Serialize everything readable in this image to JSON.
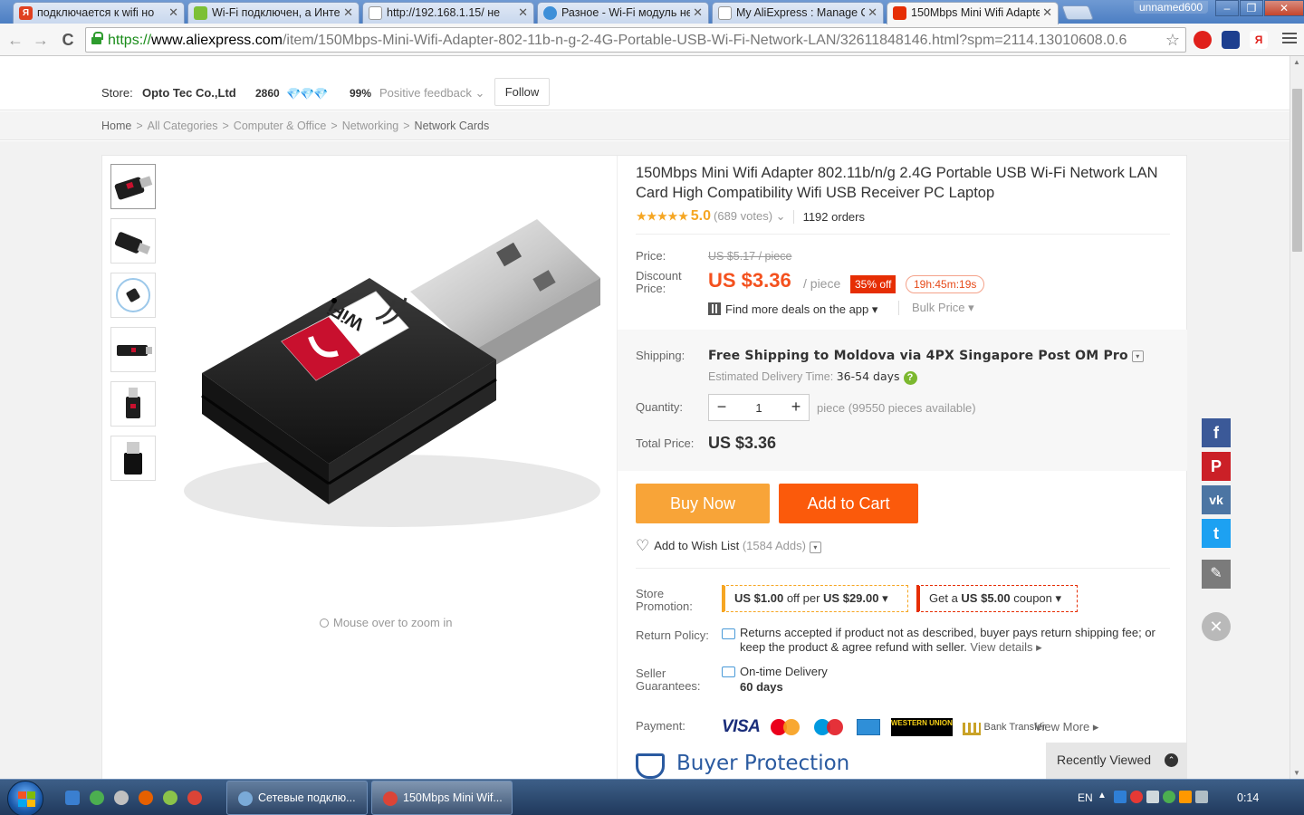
{
  "browser": {
    "tabs": [
      {
        "title": "подключается к wifi но",
        "favicon": "Я",
        "favicon_color": "#e04020",
        "active": false
      },
      {
        "title": "Wi-Fi подключен, а Инте",
        "favicon": "",
        "favicon_color": "#7cc036",
        "active": false
      },
      {
        "title": "http://192.168.1.15/ не",
        "favicon": "",
        "favicon_color": "#cccccc",
        "active": false
      },
      {
        "title": "Разное - Wi-Fi модуль не",
        "favicon": "",
        "favicon_color": "#3d8fd8",
        "active": false
      },
      {
        "title": "My AliExpress : Manage O",
        "favicon": "",
        "favicon_color": "#cccccc",
        "active": false
      },
      {
        "title": "150Mbps Mini Wifi Adapte",
        "favicon": "",
        "favicon_color": "#e62e04",
        "active": true
      }
    ],
    "profile": "unnamed600",
    "url_scheme": "https://",
    "url_host": "www.aliexpress.com",
    "url_path": "/item/150Mbps-Mini-Wifi-Adapter-802-11b-n-g-2-4G-Portable-USB-Wi-Fi-Network-LAN/32611848146.html?spm=2114.13010608.0.6",
    "back": "←",
    "forward": "→",
    "reload": "C"
  },
  "store": {
    "label": "Store:",
    "name": "Opto Tec Co.,Ltd",
    "score": "2860",
    "feedback_percent": "99%",
    "feedback_label": "Positive feedback ⌄",
    "follow": "Follow"
  },
  "breadcrumb": [
    "Home",
    "All Categories",
    "Computer & Office",
    "Networking",
    "Network Cards"
  ],
  "product": {
    "title": "150Mbps Mini Wifi Adapter 802.11b/n/g 2.4G Portable USB Wi-Fi Network LAN Card High Compatibility Wifi USB Receiver PC Laptop",
    "rating_stars": "★★★★★",
    "rating": "5.0",
    "votes": "(689 votes) ⌄",
    "orders": "1192 orders",
    "price_label": "Price:",
    "old_price": "US $5.17 / piece",
    "discount_label": "Discount Price:",
    "new_price": "US $3.36",
    "per_piece": "/ piece",
    "discount": "35% off",
    "timer": "19h:45m:19s",
    "app_deals": "Find more deals on the app ▾",
    "bulk_price": "Bulk Price ▾",
    "shipping_label": "Shipping:",
    "shipping_value": "Free Shipping to Moldova via 4PX Singapore Post OM Pro",
    "eta_label": "Estimated Delivery Time:",
    "eta_value": "36-54 days",
    "quantity_label": "Quantity:",
    "quantity": "1",
    "available": "piece (99550 pieces available)",
    "total_label": "Total Price:",
    "total": "US $3.36",
    "buy_now": "Buy Now",
    "add_to_cart": "Add to Cart",
    "wishlist": "Add to Wish List",
    "wishlist_count": "(1584 Adds)",
    "promo_label": "Store Promotion:",
    "promo1_pre": "US $1.00",
    "promo1_mid": " off per ",
    "promo1_post": "US $29.00",
    "promo2_pre": "Get a ",
    "promo2_val": "US $5.00",
    "promo2_post": " coupon",
    "return_label": "Return Policy:",
    "return_text": "Returns accepted if product not as described, buyer pays return shipping fee; or keep the product & agree refund with seller.",
    "view_details": "View details ▸",
    "guarantee_label": "Seller Guarantees:",
    "ontime": "On-time Delivery",
    "guarantee_days": "60 days",
    "payment_label": "Payment:",
    "payment_visa": "VISA",
    "payment_bank": "Bank Transfer",
    "payment_wu": "WESTERN UNION",
    "view_more": "View More ▸",
    "buyer_protection": "Buyer Protection",
    "zoom_hint": "Mouse over to zoom in",
    "image_logo": "WiFi"
  },
  "sidebar": {
    "recently_viewed": "Recently Viewed",
    "recently_icon": "⌃",
    "social": [
      {
        "name": "facebook",
        "glyph": "f",
        "color": "#3b5998"
      },
      {
        "name": "pinterest",
        "glyph": "P",
        "color": "#cb2027"
      },
      {
        "name": "vk",
        "glyph": "vk",
        "color": "#4c75a3"
      },
      {
        "name": "twitter",
        "glyph": "t",
        "color": "#1da1f2"
      }
    ],
    "edit_glyph": "✎",
    "close_glyph": "✕"
  },
  "taskbar": {
    "windows": [
      {
        "title": "Сетевые подклю...",
        "active": false
      },
      {
        "title": "150Mbps Mini Wif...",
        "active": true
      }
    ],
    "lang": "EN",
    "clock": "0:14"
  },
  "colors": {
    "accent": "#f4511e",
    "buy_now": "#f8a438",
    "add_to_cart": "#fb5a0b",
    "badge": "#e62e04",
    "star": "#f5a623",
    "buyer_protection": "#2a5aa0"
  }
}
